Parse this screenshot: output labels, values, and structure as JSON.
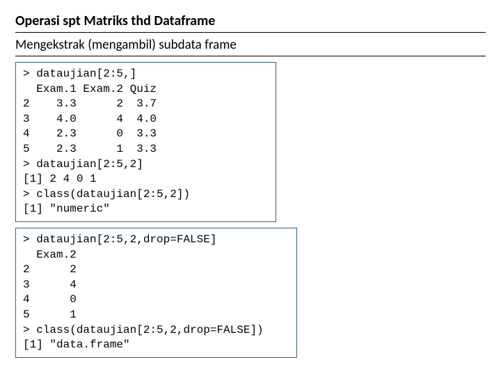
{
  "title": "Operasi spt Matriks thd Dataframe",
  "subtitle": "Mengekstrak (mengambil) subdata frame",
  "box1": "> dataujian[2:5,]\n  Exam.1 Exam.2 Quiz\n2    3.3      2  3.7\n3    4.0      4  4.0\n4    2.3      0  3.3\n5    2.3      1  3.3\n> dataujian[2:5,2]\n[1] 2 4 0 1\n> class(dataujian[2:5,2])\n[1] \"numeric\"",
  "box2": "> dataujian[2:5,2,drop=FALSE]\n  Exam.2\n2      2\n3      4\n4      0\n5      1\n> class(dataujian[2:5,2,drop=FALSE])\n[1] \"data.frame\""
}
